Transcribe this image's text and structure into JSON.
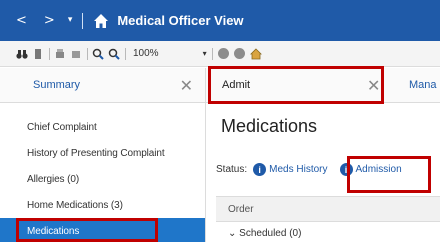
{
  "window": {
    "title": "Medical Officer View",
    "back_glyph": "<",
    "forward_glyph": ">",
    "dropdown_glyph": "▾"
  },
  "toolbar": {
    "zoom": "100%",
    "dropdown_glyph": "▾"
  },
  "left_pane": {
    "tab_label": "Summary",
    "close_glyph": "✕",
    "items": [
      {
        "label": "Chief Complaint"
      },
      {
        "label": "History of Presenting Complaint"
      },
      {
        "label": "Allergies (0)"
      },
      {
        "label": "Home Medications (3)"
      },
      {
        "label": "Medications",
        "active": true
      }
    ]
  },
  "right_pane": {
    "tab_admit": "Admit",
    "close_glyph": "✕",
    "tab_next": "Mana",
    "heading": "Medications",
    "status_label": "Status:",
    "meds_history_label": "Meds History",
    "admission_label": "Admission",
    "info_glyph": "i",
    "order_header": "Order",
    "scheduled_label": "⌄ Scheduled (0)"
  },
  "colors": {
    "title_bar": "#1f5aa8",
    "active_item": "#1f76c9",
    "highlight": "#c00000",
    "link": "#1f5aa8"
  },
  "icons": [
    "back-icon",
    "forward-icon",
    "home-icon",
    "binoculars-icon",
    "page-icon",
    "print-icon",
    "zoom-in-icon",
    "zoom-out-icon",
    "close-icon",
    "info-icon"
  ]
}
